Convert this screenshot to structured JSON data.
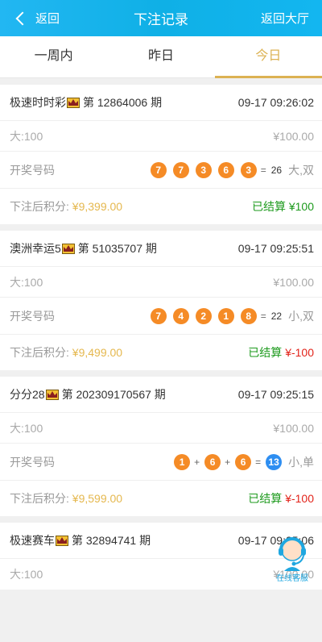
{
  "header": {
    "back_label": "返回",
    "title": "下注记录",
    "hall_label": "返回大厅"
  },
  "tabs": [
    {
      "label": "一周内",
      "active": false
    },
    {
      "label": "昨日",
      "active": false
    },
    {
      "label": "今日",
      "active": true
    }
  ],
  "records": [
    {
      "game": "极速时时彩",
      "period": "第 12864006 期",
      "time": "09-17 09:26:02",
      "bet": "大:100",
      "amount": "¥100.00",
      "draw_label": "开奖号码",
      "balls": [
        "7",
        "7",
        "3",
        "6",
        "3"
      ],
      "equals": "=",
      "sum": "26",
      "result": "大,双",
      "points_label": "下注后积分:",
      "points": "¥9,399.00",
      "status": "已结算",
      "payout": "¥100"
    },
    {
      "game": "澳洲幸运5",
      "period": "第 51035707 期",
      "time": "09-17 09:25:51",
      "bet": "大:100",
      "amount": "¥100.00",
      "draw_label": "开奖号码",
      "balls": [
        "7",
        "4",
        "2",
        "1",
        "8"
      ],
      "equals": "=",
      "sum": "22",
      "result": "小,双",
      "points_label": "下注后积分:",
      "points": "¥9,499.00",
      "status": "已结算",
      "payout": "¥-100"
    },
    {
      "game": "分分28",
      "period": "第 202309170567 期",
      "time": "09-17 09:25:15",
      "bet": "大:100",
      "amount": "¥100.00",
      "draw_label": "开奖号码",
      "balls": [
        "1",
        "6",
        "6"
      ],
      "plus": "+",
      "equals": "=",
      "sum": "13",
      "result": "小,单",
      "points_label": "下注后积分:",
      "points": "¥9,599.00",
      "status": "已结算",
      "payout": "¥-100"
    },
    {
      "game": "极速赛车",
      "period": "第 32894741 期",
      "time": "09-17 09:25:06",
      "bet": "大:100",
      "amount": "¥100.00"
    }
  ],
  "service": {
    "label": "在线客服",
    "icon": "headset-icon"
  },
  "colors": {
    "header": "#13b6f0",
    "active_tab": "#dcb253",
    "ball_orange": "#f58b26",
    "ball_blue": "#2e8ef1",
    "settled_green": "#1d9a1d",
    "loss_red": "#e2231a",
    "points_gold": "#e5b84f"
  }
}
